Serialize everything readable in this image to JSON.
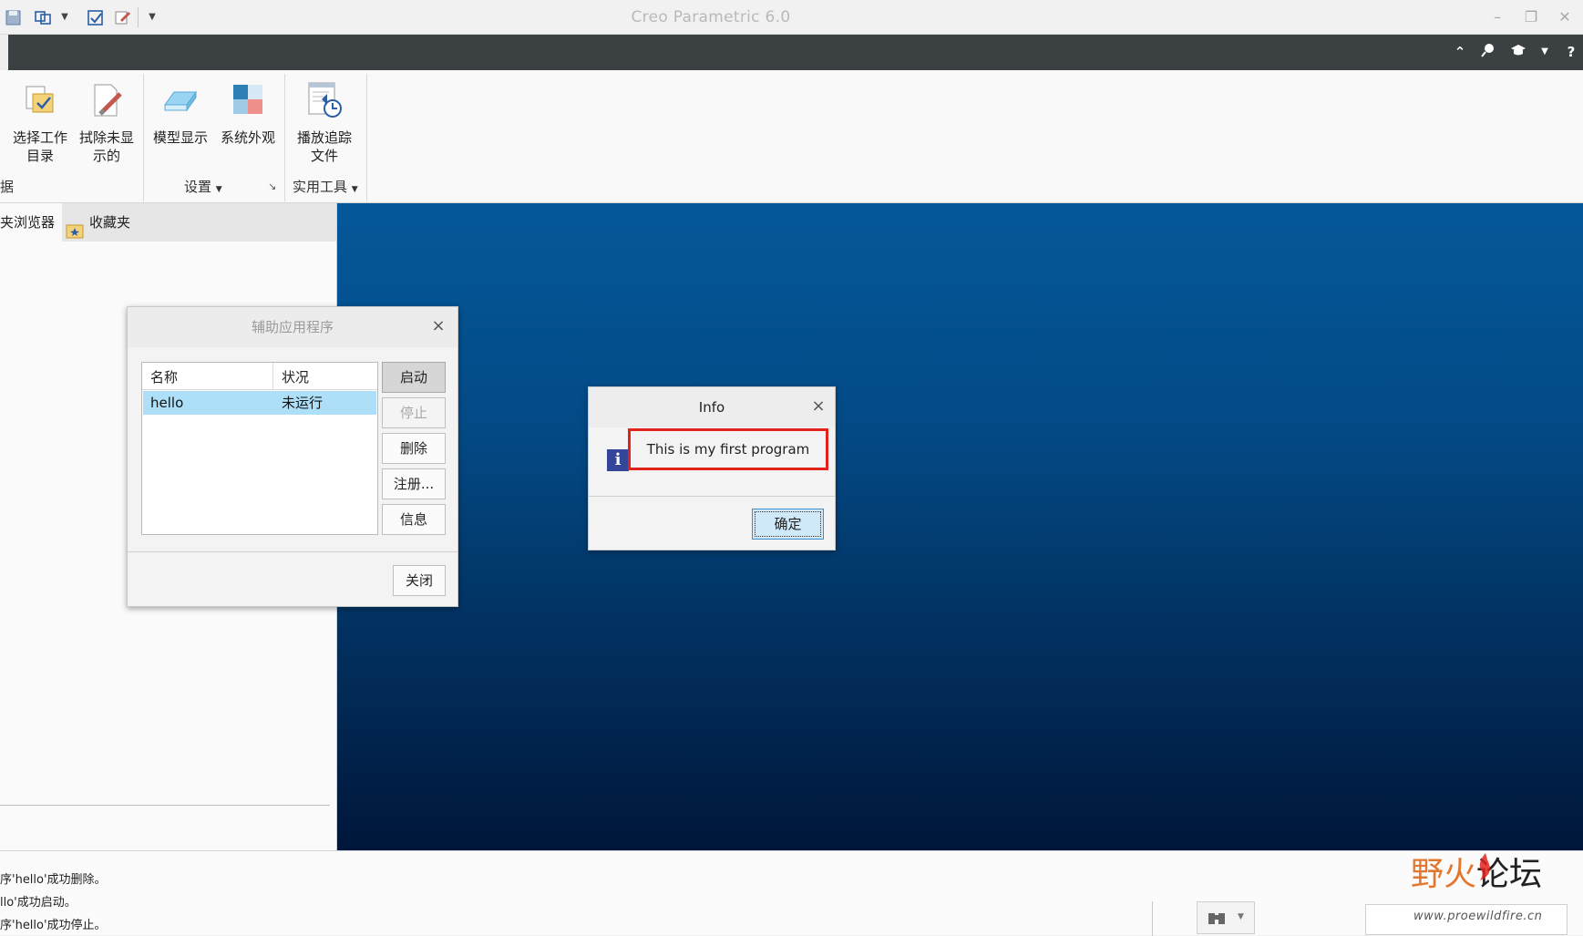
{
  "app": {
    "title": "Creo Parametric 6.0"
  },
  "ribbon": {
    "buttons": [
      {
        "label": "选择工作\n目录",
        "icon": "select-working-directory-icon"
      },
      {
        "label": "拭除未显\n示的",
        "icon": "erase-not-displayed-icon"
      },
      {
        "label": "模型显示",
        "icon": "model-display-icon"
      },
      {
        "label": "系统外观",
        "icon": "system-appearance-icon"
      },
      {
        "label": "播放追踪\n文件",
        "icon": "play-trail-file-icon"
      }
    ],
    "groups": {
      "left_partial": "据",
      "settings": "设置",
      "utilities": "实用工具"
    }
  },
  "left_panel": {
    "tabs": [
      "夹浏览器",
      "收藏夹"
    ]
  },
  "aux_dialog": {
    "title": "辅助应用程序",
    "columns": [
      "名称",
      "状况"
    ],
    "rows": [
      {
        "name": "hello",
        "status": "未运行"
      }
    ],
    "buttons": {
      "start": "启动",
      "stop": "停止",
      "delete": "删除",
      "register": "注册...",
      "info": "信息",
      "close": "关闭"
    }
  },
  "info_dialog": {
    "title": "Info",
    "message": "This is my first program",
    "ok": "确定"
  },
  "messages": [
    "序'hello'成功删除。",
    "llo'成功启动。",
    "序'hello'成功停止。"
  ],
  "watermark": {
    "text": "野火论坛",
    "url": "www.proewildfire.cn"
  },
  "colors": {
    "dark_bar": "#3b4043",
    "graphics_top": "#04589a",
    "graphics_bottom": "#00163a",
    "selection": "#ade0f8",
    "highlight_box": "#e2221d"
  }
}
